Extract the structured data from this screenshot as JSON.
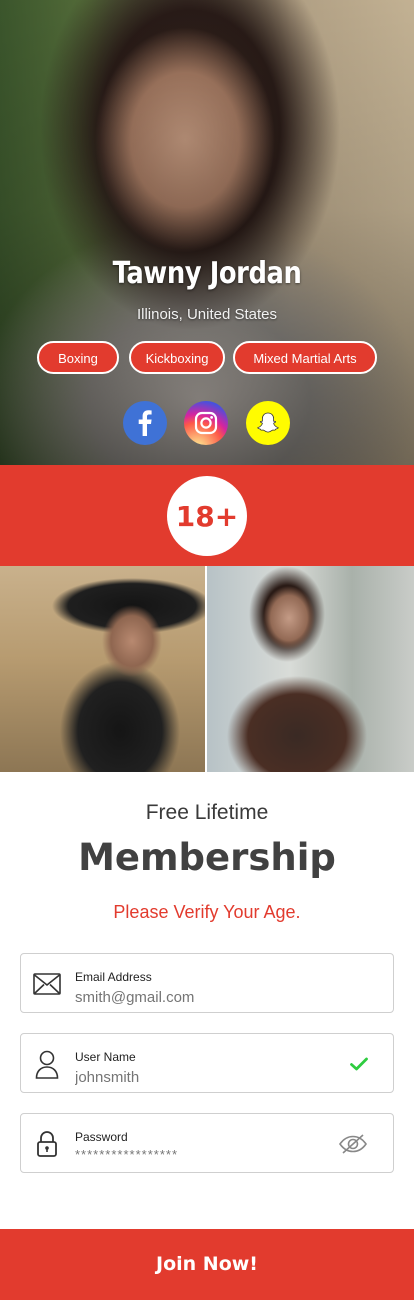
{
  "profile": {
    "name": "Tawny Jordan",
    "location": "Illinois, United States",
    "tags": [
      "Boxing",
      "Kickboxing",
      "Mixed Martial Arts"
    ],
    "social": [
      {
        "name": "facebook-icon",
        "color": "#3f72d6"
      },
      {
        "name": "instagram-icon",
        "color": "#d6249f"
      },
      {
        "name": "snapchat-icon",
        "color": "#fffc00"
      }
    ]
  },
  "age_badge": "18+",
  "membership": {
    "subtitle": "Free Lifetime",
    "title": "Membership",
    "prompt": "Please Verify Your Age."
  },
  "form": {
    "email": {
      "label": "Email Address",
      "placeholder": "smith@gmail.com",
      "icon": "envelope-icon"
    },
    "username": {
      "label": "User Name",
      "placeholder": "johnsmith",
      "icon": "user-icon",
      "status_icon": "checkmark-icon"
    },
    "password": {
      "label": "Password",
      "placeholder": "*****************",
      "icon": "lock-icon",
      "toggle_icon": "eye-slash-icon"
    }
  },
  "join_button": "Join Now!",
  "colors": {
    "accent": "#e23b2e",
    "success": "#2ecc40",
    "text_dark": "#414141"
  }
}
